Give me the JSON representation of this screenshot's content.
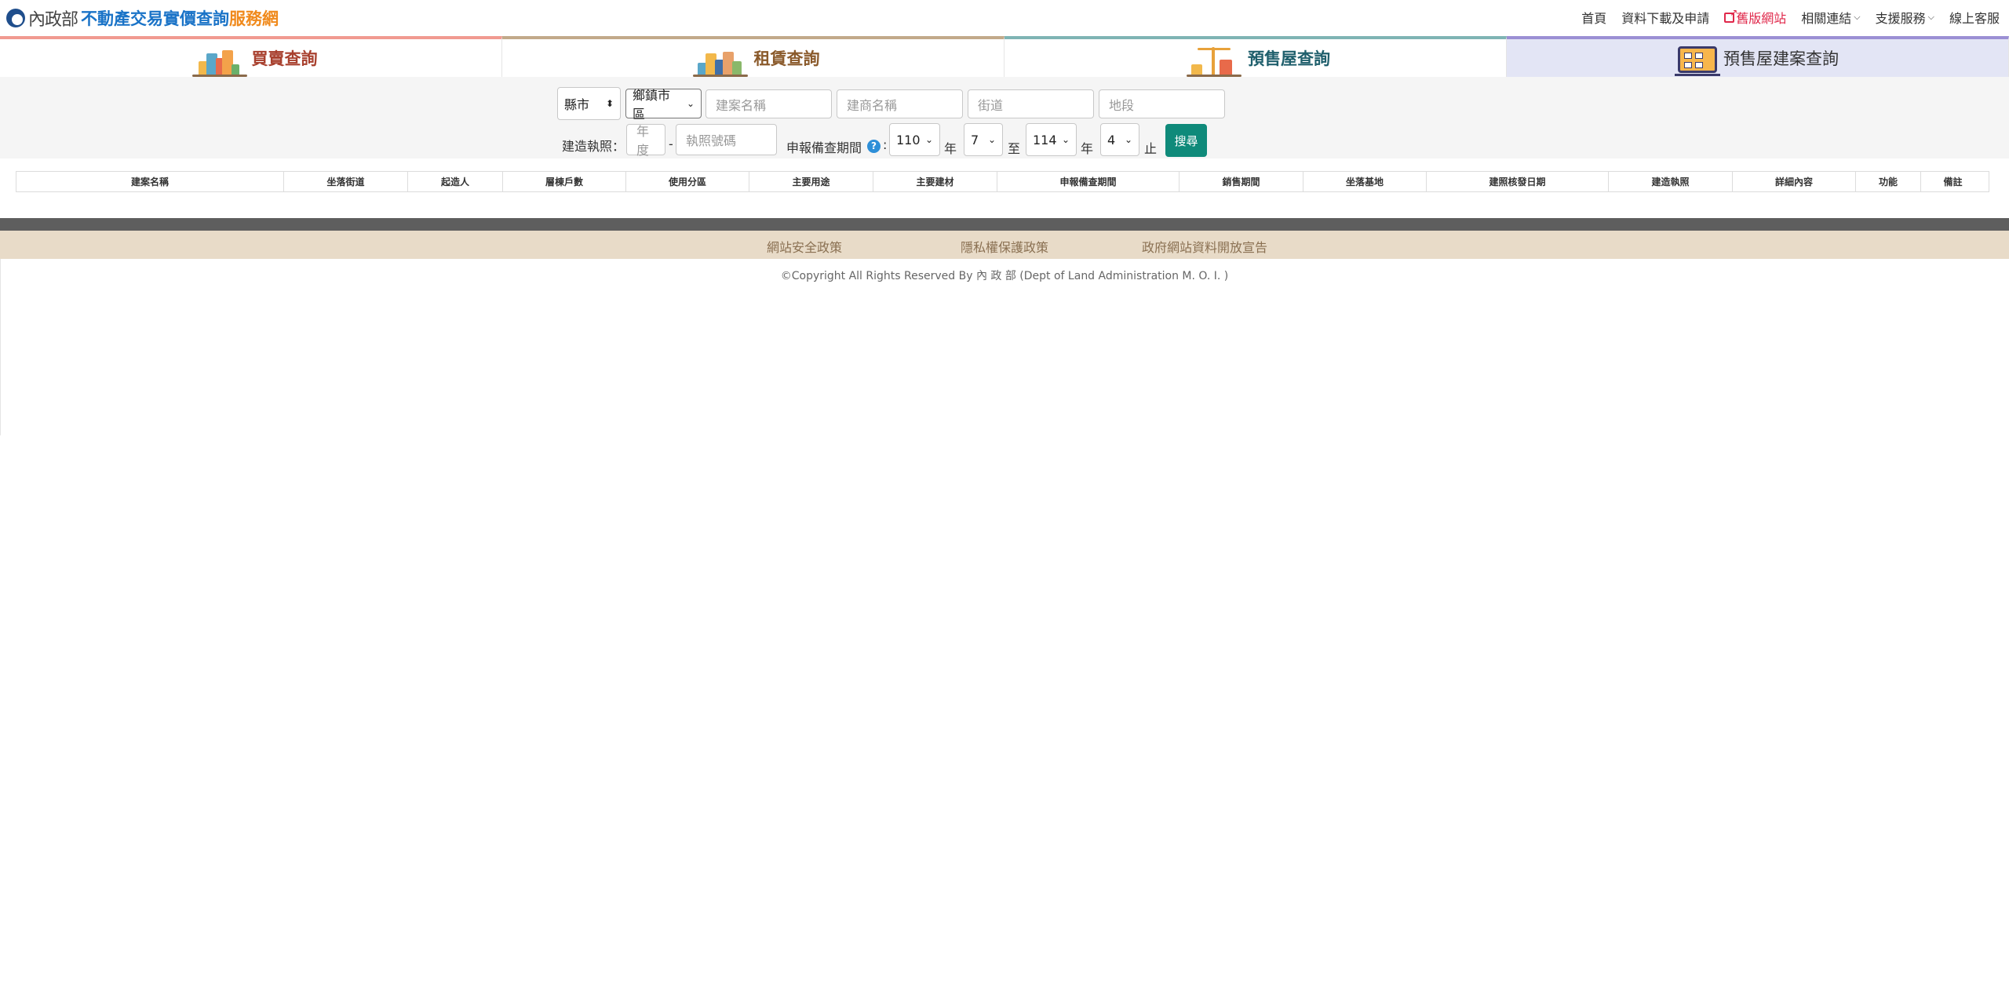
{
  "header": {
    "logo_moi": "內政部",
    "logo_main": "不動產交易實價查詢",
    "logo_suffix": "服務網",
    "nav": [
      {
        "label": "首頁"
      },
      {
        "label": "資料下載及申請"
      },
      {
        "label": "舊版網站"
      },
      {
        "label": "相關連結"
      },
      {
        "label": "支援服務"
      },
      {
        "label": "線上客服"
      }
    ]
  },
  "tabs": [
    {
      "label": "買賣查詢",
      "color": "#f19a90"
    },
    {
      "label": "租賃查詢",
      "color": "#c2a98a"
    },
    {
      "label": "預售屋查詢",
      "color": "#7fb4b4"
    },
    {
      "label": "預售屋建案查詢",
      "color": "#9b8fd4",
      "active": true
    }
  ],
  "search": {
    "county": "縣市",
    "district": "鄉鎮市區",
    "project_name_placeholder": "建案名稱",
    "builder_name_placeholder": "建商名稱",
    "street_placeholder": "街道",
    "land_section_placeholder": "地段",
    "permit_label": "建造執照：",
    "permit_year_placeholder": "年度",
    "permit_dash": "-",
    "permit_no_placeholder": "執照號碼",
    "period_label": "申報備查期間",
    "help": "?",
    "colon": ":",
    "from_year": "110",
    "year_unit_1": "年",
    "from_month": "7",
    "to_label": "至",
    "to_year": "114",
    "year_unit_2": "年",
    "to_month": "4",
    "end_label": "止",
    "search_button": "搜尋"
  },
  "table": {
    "headers": [
      "建案名稱",
      "坐落街道",
      "起造人",
      "層棟戶數",
      "使用分區",
      "主要用途",
      "主要建材",
      "申報備查期間",
      "銷售期間",
      "坐落基地",
      "建照核發日期",
      "建造執照",
      "詳細內容",
      "功能",
      "備註"
    ]
  },
  "footer": {
    "links": [
      "網站安全政策",
      "隱私權保護政策",
      "政府網站資料開放宣告"
    ],
    "copyright": "©Copyright All Rights Reserved By 內 政 部 (Dept of Land Administration M. O. I. )"
  },
  "colors": {
    "accent": "#0f8a7a",
    "brand_blue": "#1a73c7",
    "brand_orange": "#f08a1c",
    "old_site_red": "#e0284b"
  }
}
